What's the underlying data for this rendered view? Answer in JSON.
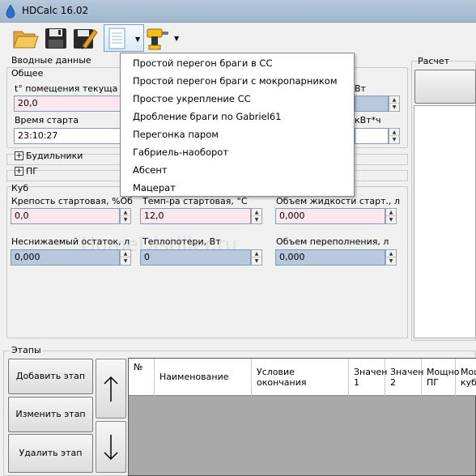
{
  "window": {
    "title": "HDCalc 16.02"
  },
  "toolbar": {
    "icons": [
      "folder-open-icon",
      "save-icon",
      "save-as-icon",
      "document-icon",
      "drill-icon"
    ]
  },
  "left_panel": {
    "group_title": "Вводные данные",
    "general_title": "Общее",
    "room_temp_label": "t° помещения текуща",
    "room_temp_value": "20,0",
    "start_time_label": "Время старта",
    "start_time_value": "23:10:27",
    "right_label_partial_1": "Вт",
    "right_label_partial_2": "кВт*ч",
    "alarms_label": "Будильники",
    "pg_label": "ПГ"
  },
  "cube": {
    "title": "Куб",
    "start_strength_label": "Крепость стартовая, %Об",
    "start_strength_value": "0,0",
    "start_temp_label": "Темп-ра стартовая, °С",
    "start_temp_value": "12,0",
    "start_volume_label": "Объем жидкости старт., л",
    "start_volume_value": "0,000",
    "residue_label": "Неснижаемый остаток, л",
    "residue_value": "0,000",
    "heat_loss_label": "Теплопотери, Вт",
    "heat_loss_value": "0",
    "overflow_label": "Объем переполнения, л",
    "overflow_value": "0,000"
  },
  "right_panel": {
    "title": "Расчет"
  },
  "menu": {
    "items": [
      "Простой перегон браги в СС",
      "Простой перегон браги с мокропарником",
      "Простое укрепление СС",
      "Дробление браги по Gabriel61",
      "Перегонка паром",
      "Габриель-наоборот",
      "Абсент",
      "Мацерат"
    ]
  },
  "stages": {
    "title": "Этапы",
    "add_button": "Добавить этап",
    "edit_button": "Изменить этап",
    "delete_button": "Удалить этап",
    "columns": [
      {
        "line1": "№",
        "line2": ""
      },
      {
        "line1": "Наименование",
        "line2": ""
      },
      {
        "line1": "Условие",
        "line2": "окончания"
      },
      {
        "line1": "Значен",
        "line2": "1"
      },
      {
        "line1": "Значен",
        "line2": "2"
      },
      {
        "line1": "Мощно",
        "line2": "ПГ"
      },
      {
        "line1": "Мощн",
        "line2": "куб"
      }
    ]
  },
  "watermark": "HomeDistiller.ru",
  "colors": {
    "pink_input": "#fde7ee",
    "blue_input": "#b9c9dd",
    "grid_bg": "#a9a9a9",
    "titlebar": "#9fb6cd"
  }
}
